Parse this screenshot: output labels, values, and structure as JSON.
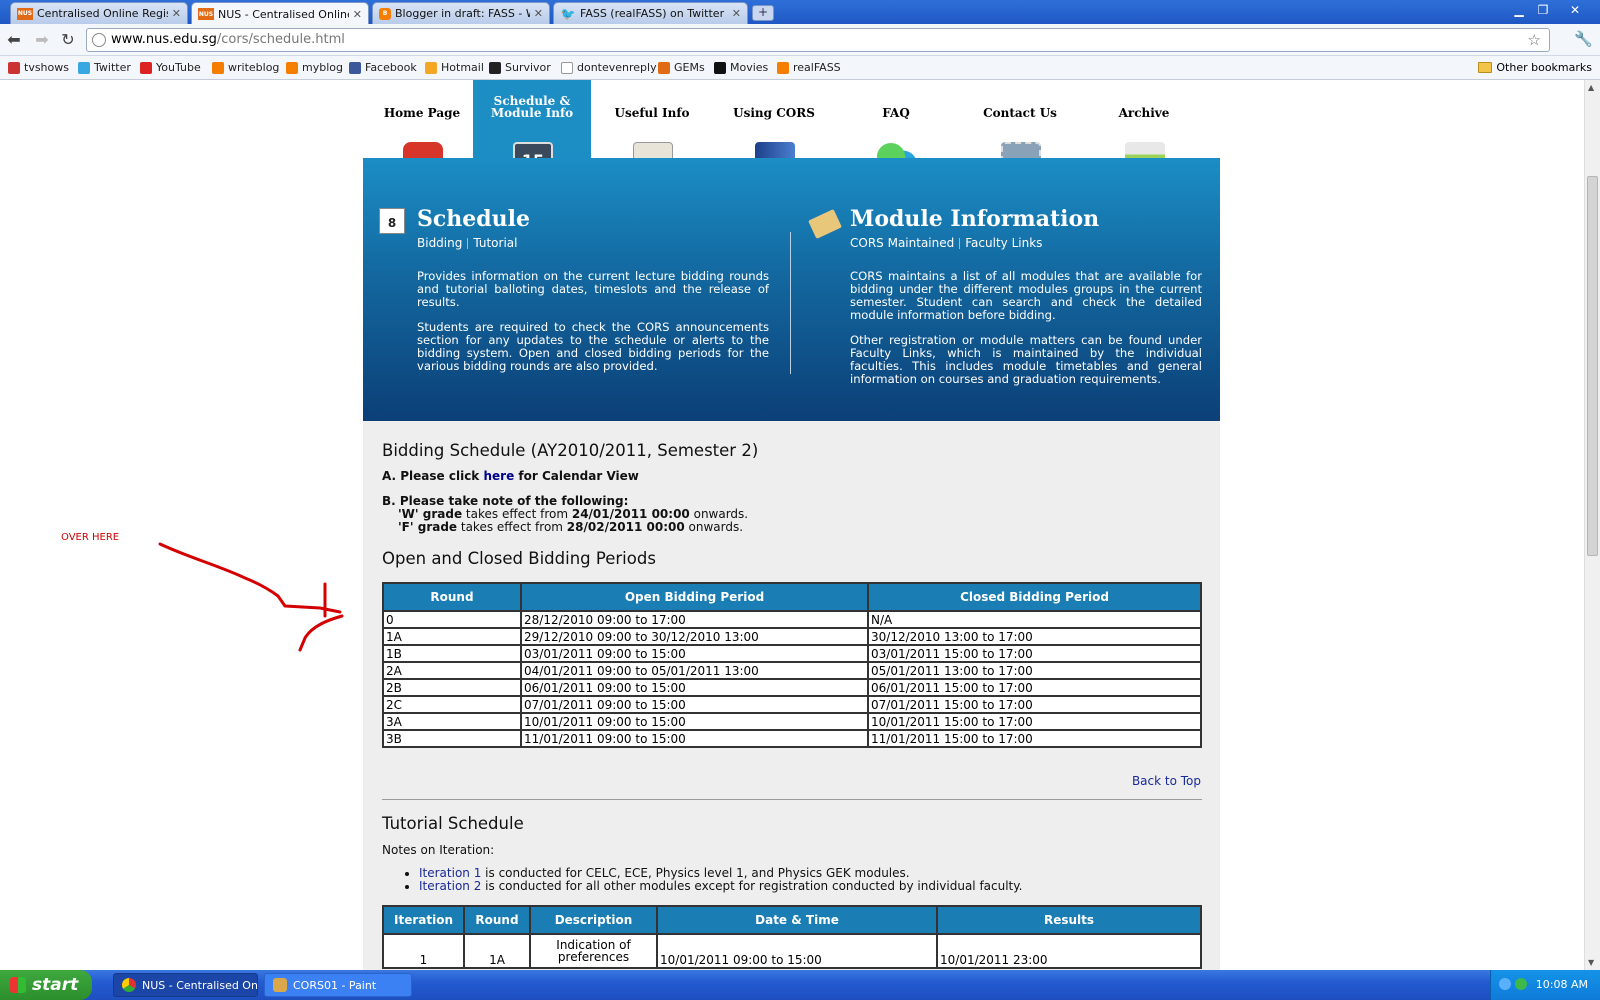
{
  "browser": {
    "tabs": [
      {
        "title": "Centralised Online Registra...",
        "icon": "nus",
        "active": false
      },
      {
        "title": "NUS - Centralised Online R...",
        "icon": "nus",
        "active": true
      },
      {
        "title": "Blogger in draft: FASS - W...",
        "icon": "blogger",
        "active": false
      },
      {
        "title": "FASS (realFASS) on Twitter",
        "icon": "twitter",
        "active": false
      }
    ],
    "url_host": "www.nus.edu.sg",
    "url_path": "/cors/schedule.html",
    "bookmarks": [
      "tvshows",
      "Twitter",
      "YouTube",
      "writeblog",
      "myblog",
      "Facebook",
      "Hotmail",
      "Survivor",
      "dontevenreply",
      "GEMs",
      "Movies",
      "realFASS"
    ],
    "other_bookmarks": "Other bookmarks"
  },
  "nav": {
    "items": [
      "Home Page",
      "Schedule &",
      "Module Info",
      "Useful Info",
      "Using CORS",
      "FAQ",
      "Contact Us",
      "Archive"
    ]
  },
  "hero": {
    "schedule": {
      "title": "Schedule",
      "link1": "Bidding",
      "link2": "Tutorial",
      "para1": "Provides information on the current lecture bidding rounds and tutorial balloting dates, timeslots and the release of results.",
      "para2": "Students are required to check the CORS announcements section for any updates to the schedule or alerts to the bidding system. Open and closed bidding periods for the various bidding rounds are also provided.",
      "cal_day": "8"
    },
    "module": {
      "title": "Module Information",
      "link1": "CORS Maintained",
      "link2": "Faculty Links",
      "para1": "CORS maintains a list of all modules that are available for bidding under the different modules groups in the current semester. Student can search and check the detailed module information before bidding.",
      "para2": "Other registration or module matters can be found under Faculty Links, which is maintained by the individual faculties. This includes module timetables and general information on courses and graduation requirements."
    }
  },
  "bidding": {
    "heading": "Bidding Schedule (AY2010/2011, Semester 2)",
    "noteA_prefix": "A. Please click ",
    "noteA_link": "here",
    "noteA_suffix": " for Calendar View",
    "noteB": "B. Please take note of the following:",
    "w_label": "'W' grade",
    "w_mid": " takes effect from ",
    "w_date": "24/01/2011 00:00",
    "w_end": " onwards.",
    "f_label": "'F' grade",
    "f_mid": " takes effect from ",
    "f_date": "28/02/2011 00:00",
    "f_end": " onwards.",
    "periods_heading": "Open and Closed Bidding Periods",
    "columns": [
      "Round",
      "Open Bidding Period",
      "Closed Bidding Period"
    ],
    "rows": [
      [
        "0",
        "28/12/2010 09:00 to 17:00",
        "N/A"
      ],
      [
        "1A",
        "29/12/2010 09:00 to 30/12/2010 13:00",
        "30/12/2010 13:00 to 17:00"
      ],
      [
        "1B",
        "03/01/2011 09:00 to 15:00",
        "03/01/2011 15:00 to 17:00"
      ],
      [
        "2A",
        "04/01/2011 09:00 to 05/01/2011 13:00",
        "05/01/2011 13:00 to 17:00"
      ],
      [
        "2B",
        "06/01/2011 09:00 to 15:00",
        "06/01/2011 15:00 to 17:00"
      ],
      [
        "2C",
        "07/01/2011 09:00 to 15:00",
        "07/01/2011 15:00 to 17:00"
      ],
      [
        "3A",
        "10/01/2011 09:00 to 15:00",
        "10/01/2011 15:00 to 17:00"
      ],
      [
        "3B",
        "11/01/2011 09:00 to 15:00",
        "11/01/2011 15:00 to 17:00"
      ]
    ],
    "back_to_top": "Back to Top"
  },
  "tutorial": {
    "heading": "Tutorial Schedule",
    "notes_label": "Notes on Iteration:",
    "iter1_link": "Iteration 1",
    "iter1_text": " is conducted for CELC, ECE, Physics level 1, and Physics GEK modules.",
    "iter2_link": "Iteration 2",
    "iter2_text": " is conducted for all other modules except for registration conducted by individual faculty.",
    "columns": [
      "Iteration",
      "Round",
      "Description",
      "Date & Time",
      "Results"
    ],
    "first_row": [
      "1",
      "1A",
      "Indication of preferences",
      "10/01/2011 09:00 to 15:00",
      "10/01/2011 23:00"
    ]
  },
  "annotation": {
    "text": "OVER HERE",
    "color": "#cc0000"
  },
  "taskbar": {
    "start": "start",
    "buttons": [
      "NUS - Centralised Onl...",
      "CORS01 - Paint"
    ],
    "clock": "10:08 AM"
  },
  "colors": {
    "accent": "#1a7db4",
    "hero_dark": "#0c3f77"
  }
}
